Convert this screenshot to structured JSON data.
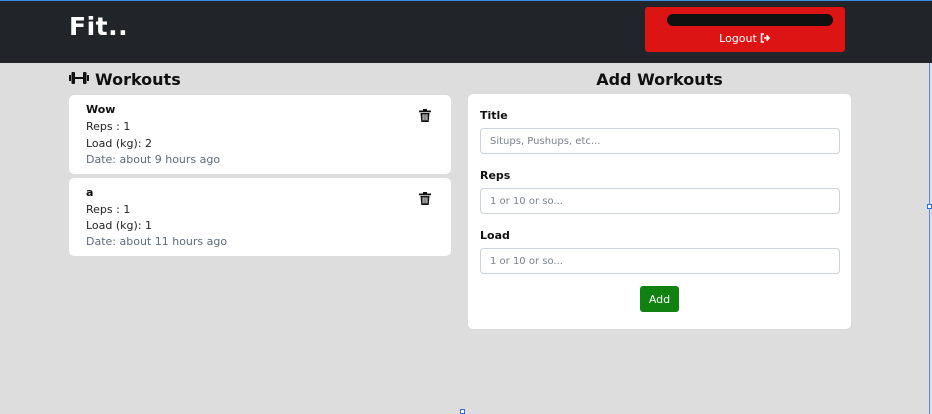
{
  "navbar": {
    "brand": "Fit..",
    "logout_label": "Logout",
    "logout_icon": "sign-out-icon",
    "user_box_color": "#dc1414"
  },
  "workouts": {
    "heading": "Workouts",
    "heading_icon": "dumbbell-icon",
    "items": [
      {
        "title": "Wow",
        "reps": "Reps : 1",
        "load": "Load (kg): 2",
        "date": "Date: about 9 hours ago"
      },
      {
        "title": "a",
        "reps": "Reps : 1",
        "load": "Load (kg): 1",
        "date": "Date: about 11 hours ago"
      }
    ]
  },
  "add_form": {
    "heading": "Add Workouts",
    "title_label": "Title",
    "title_placeholder": "Situps, Pushups, etc...",
    "reps_label": "Reps",
    "reps_placeholder": "1 or 10 or so...",
    "load_label": "Load",
    "load_placeholder": "1 or 10 or so...",
    "submit_label": "Add",
    "submit_color": "#118211"
  }
}
